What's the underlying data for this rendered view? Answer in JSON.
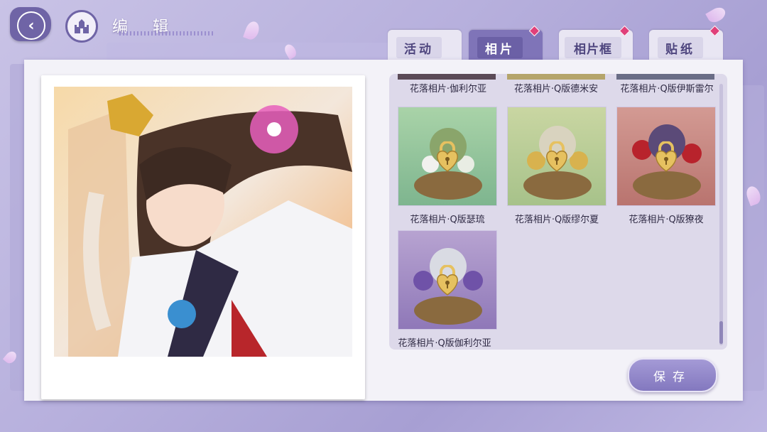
{
  "header": {
    "title": "编 辑"
  },
  "tabs": [
    {
      "label": "活动",
      "active": false,
      "badge": false
    },
    {
      "label": "相片",
      "active": true,
      "badge": true
    },
    {
      "label": "相片框",
      "active": false,
      "badge": true
    },
    {
      "label": "贴纸",
      "active": false,
      "badge": true
    }
  ],
  "top_row_captions": [
    "花落相片·伽利尔亚",
    "花落相片·Q版德米安",
    "花落相片·Q版伊斯雷尔"
  ],
  "photos": [
    {
      "caption": "花落相片·Q版瑟琉",
      "bg": "#9fcaa0",
      "locked": true
    },
    {
      "caption": "花落相片·Q版缪尔夏",
      "bg": "#b8cf9a",
      "locked": true
    },
    {
      "caption": "花落相片·Q版獠夜",
      "bg": "#c58a86",
      "locked": true
    },
    {
      "caption": "花落相片·Q版伽利尔亚",
      "bg": "#a58fc4",
      "locked": true
    }
  ],
  "save_button": {
    "label": "保存"
  },
  "colors": {
    "accent": "#7f74b8",
    "badge": "#e0407a",
    "lock_gold": "#e6c160"
  },
  "icons": {
    "back": "back-arrow-icon",
    "home": "castle-icon",
    "lock": "heart-lock-icon"
  }
}
